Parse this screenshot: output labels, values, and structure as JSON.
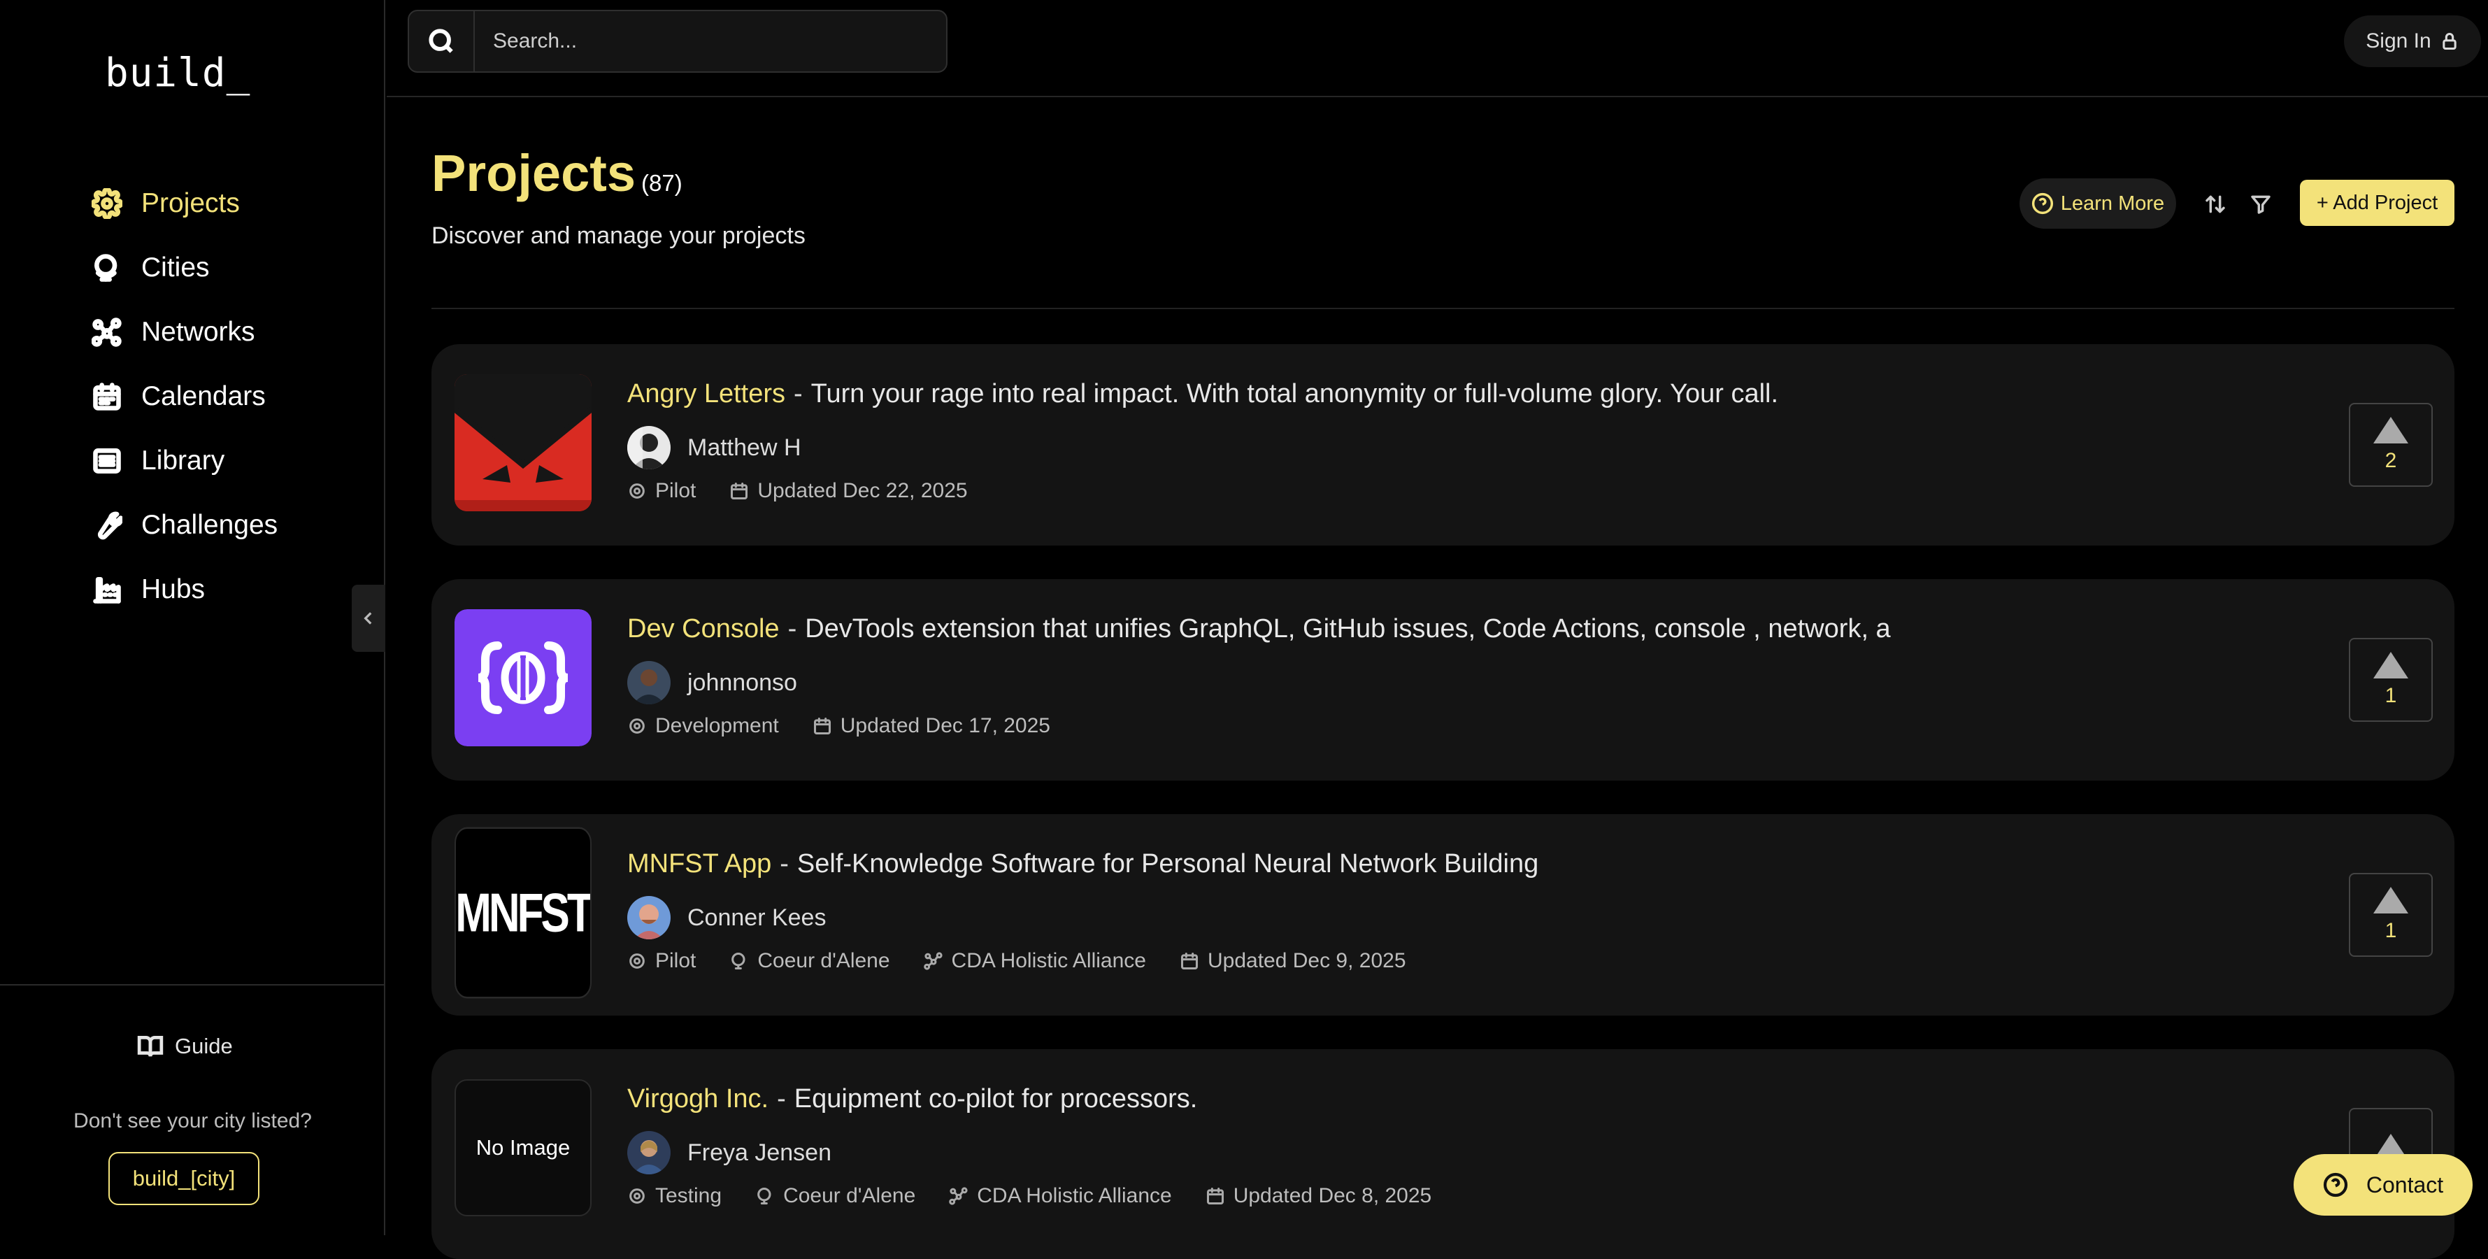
{
  "app": {
    "logo": "build_"
  },
  "sidebar": {
    "items": [
      {
        "label": "Projects",
        "icon": "gear-icon",
        "active": true
      },
      {
        "label": "Cities",
        "icon": "globe-icon",
        "active": false
      },
      {
        "label": "Networks",
        "icon": "network-icon",
        "active": false
      },
      {
        "label": "Calendars",
        "icon": "calendar-icon",
        "active": false
      },
      {
        "label": "Library",
        "icon": "list-icon",
        "active": false
      },
      {
        "label": "Challenges",
        "icon": "wrench-icon",
        "active": false
      },
      {
        "label": "Hubs",
        "icon": "building-icon",
        "active": false
      }
    ],
    "guide_label": "Guide",
    "city_question": "Don't see your city listed?",
    "city_button": "build_[city]"
  },
  "topbar": {
    "search_placeholder": "Search...",
    "signin_label": "Sign In"
  },
  "header": {
    "title": "Projects",
    "count": "(87)",
    "subtitle": "Discover and manage your projects",
    "learn_more": "Learn More",
    "add_project": "+ Add Project"
  },
  "projects": [
    {
      "name": "Angry Letters",
      "description": "Turn your rage into real impact. With total anonymity or full-volume glory. Your call.",
      "author": "Matthew H",
      "stage": "Pilot",
      "updated": "Updated Dec 22, 2025",
      "votes": "2",
      "thumb": "angry-letters-logo"
    },
    {
      "name": "Dev Console",
      "description": "DevTools extension that unifies GraphQL, GitHub issues, Code Actions, console , network, a",
      "author": "johnnonso",
      "stage": "Development",
      "updated": "Updated Dec 17, 2025",
      "votes": "1",
      "thumb": "dev-console-logo"
    },
    {
      "name": "MNFST App",
      "description": "Self-Knowledge Software for Personal Neural Network Building",
      "author": "Conner Kees",
      "stage": "Pilot",
      "city": "Coeur d'Alene",
      "network": "CDA Holistic Alliance",
      "updated": "Updated Dec 9, 2025",
      "votes": "1",
      "thumb_text": "MNFST"
    },
    {
      "name": "Virgogh Inc.",
      "description": "Equipment co-pilot for processors.",
      "author": "Freya Jensen",
      "stage": "Testing",
      "city": "Coeur d'Alene",
      "network": "CDA Holistic Alliance",
      "updated": "Updated Dec 8, 2025",
      "votes": "",
      "thumb_text": "No Image"
    }
  ],
  "separator": "-",
  "contact_label": "Contact",
  "colors": {
    "accent": "#f3e27a",
    "background": "#000000",
    "card": "#141414"
  }
}
